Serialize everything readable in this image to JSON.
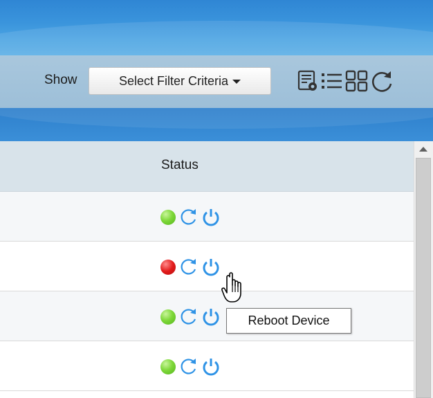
{
  "toolbar": {
    "show_label": "Show",
    "filter_button_label": "Select Filter Criteria",
    "icons": [
      "view-details-icon",
      "list-view-icon",
      "grid-view-icon",
      "refresh-icon"
    ]
  },
  "table": {
    "column_header": "Status",
    "rows": [
      {
        "status": "online",
        "status_color": "#6cc92c"
      },
      {
        "status": "offline",
        "status_color": "#e21b1b"
      },
      {
        "status": "online",
        "status_color": "#6cc92c"
      },
      {
        "status": "online",
        "status_color": "#6cc92c"
      }
    ]
  },
  "tooltip": {
    "text": "Reboot Device"
  },
  "colors": {
    "header_blue": "#3a94dc",
    "toolbar_bg": "#a9c7dd",
    "table_header_bg": "#d8e3ea",
    "action_blue": "#2f93e6"
  }
}
